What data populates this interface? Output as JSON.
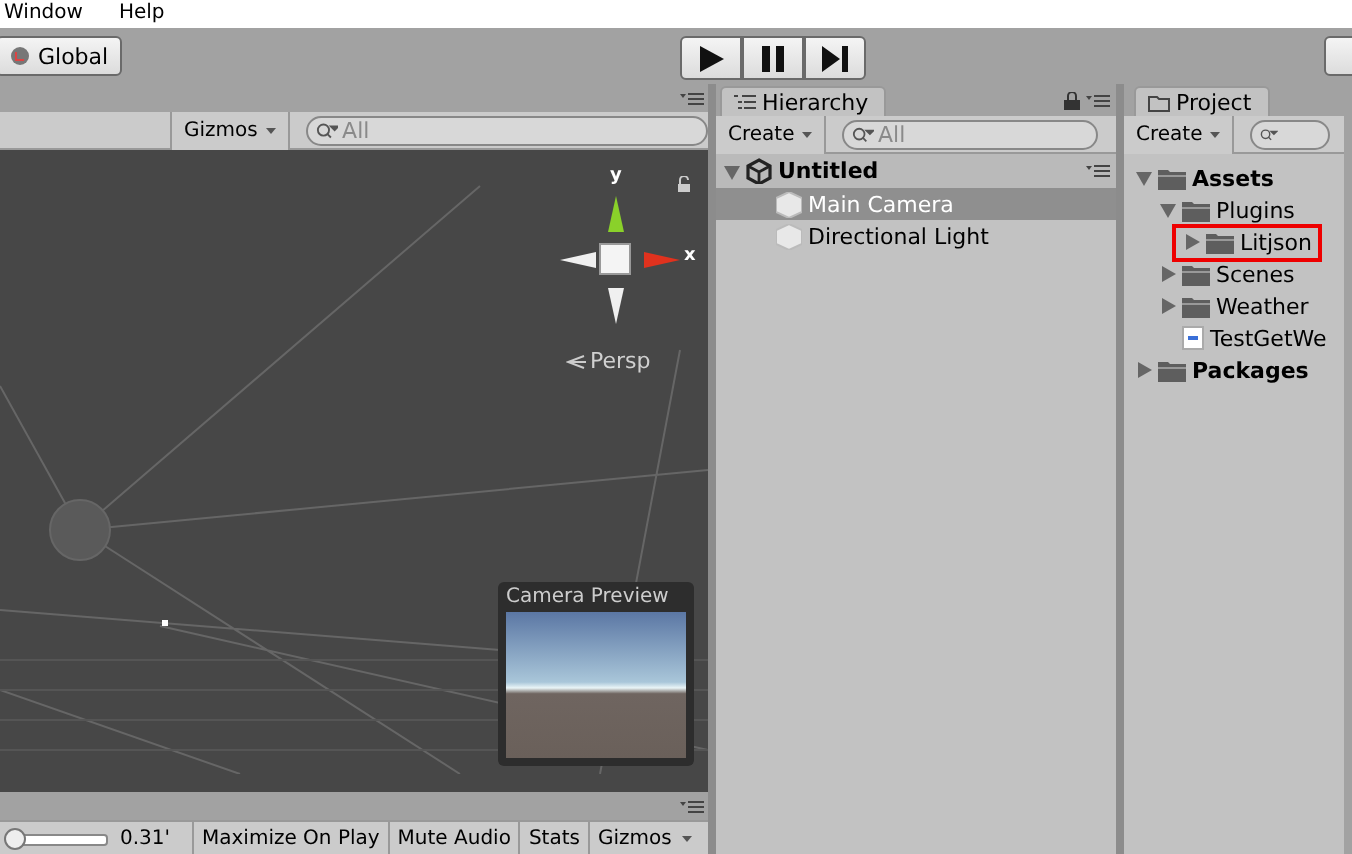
{
  "menu": [
    "Window",
    "Help"
  ],
  "toolbar": {
    "pivot_rotation": "Global"
  },
  "scene": {
    "gizmos": "Gizmos",
    "search": {
      "placeholder": "All"
    },
    "axes": {
      "y": "y",
      "x": "x"
    },
    "projection": "Persp",
    "camera_preview": {
      "title": "Camera Preview"
    }
  },
  "game": {
    "scale": {
      "level": 0.04,
      "reading": "0.31'"
    },
    "buttons": [
      {
        "label": "Maximize On Play",
        "kind": "toggle"
      },
      {
        "label": "Mute Audio",
        "kind": "toggle"
      },
      {
        "label": "Stats",
        "kind": "toggle"
      },
      {
        "label": "Gizmos",
        "kind": "dropdown"
      }
    ]
  },
  "hierarchy": {
    "tab": "Hierarchy",
    "create": "Create",
    "search": {
      "placeholder": "All"
    },
    "scene": {
      "name": "Untitled",
      "expanded": true
    },
    "objects": [
      {
        "name": "Main Camera",
        "selected": true
      },
      {
        "name": "Directional Light",
        "selected": false
      }
    ]
  },
  "project": {
    "tab": "Project",
    "create": "Create",
    "tree": [
      {
        "name": "Assets",
        "kind": "folder",
        "expanded": true,
        "highlighted": false,
        "children": [
          {
            "name": "Plugins",
            "kind": "folder",
            "expanded": true,
            "highlighted": false,
            "children": [
              {
                "name": "Litjson",
                "kind": "folder",
                "expanded": false,
                "highlighted": true
              }
            ]
          },
          {
            "name": "Scenes",
            "kind": "folder",
            "expanded": false,
            "highlighted": false
          },
          {
            "name": "Weather",
            "kind": "folder",
            "expanded": false,
            "highlighted": false
          },
          {
            "name": "TestGetWe",
            "kind": "script",
            "highlighted": false
          }
        ]
      },
      {
        "name": "Packages",
        "kind": "folder",
        "expanded": false,
        "highlighted": false
      }
    ]
  }
}
